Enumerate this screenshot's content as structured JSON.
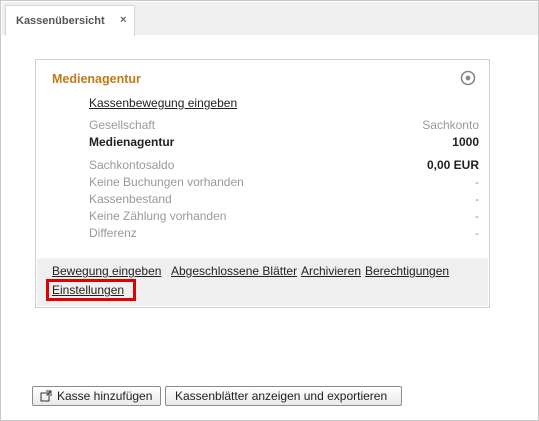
{
  "tab": {
    "label": "Kassenübersicht",
    "close": "×"
  },
  "card": {
    "title": "Medienagentur",
    "icon": "target-icon",
    "move_link": "Kassenbewegung eingeben",
    "rows": [
      {
        "label": "Gesellschaft",
        "value": "Sachkonto"
      },
      {
        "label": "Medienagentur",
        "value": "1000"
      },
      {
        "label": "Sachkontosaldo",
        "value": "0,00 EUR"
      },
      {
        "label": "Keine Buchungen vorhanden",
        "value": "-"
      },
      {
        "label": "Kassenbestand",
        "value": "-"
      },
      {
        "label": "Keine Zählung vorhanden",
        "value": "-"
      },
      {
        "label": "Differenz",
        "value": "-"
      }
    ],
    "footer_links": {
      "movement": "Bewegung eingeben",
      "closed_sheets": "Abgeschlossene Blätter",
      "archive": "Archivieren",
      "permissions": "Berechtigungen",
      "settings": "Einstellungen"
    }
  },
  "buttons": {
    "add_register": "Kasse hinzufügen",
    "add_icon": "add-window-icon",
    "show_export": "Kassenblätter anzeigen und exportieren"
  },
  "colors": {
    "title": "#c07a18",
    "highlight": "#e00000"
  }
}
